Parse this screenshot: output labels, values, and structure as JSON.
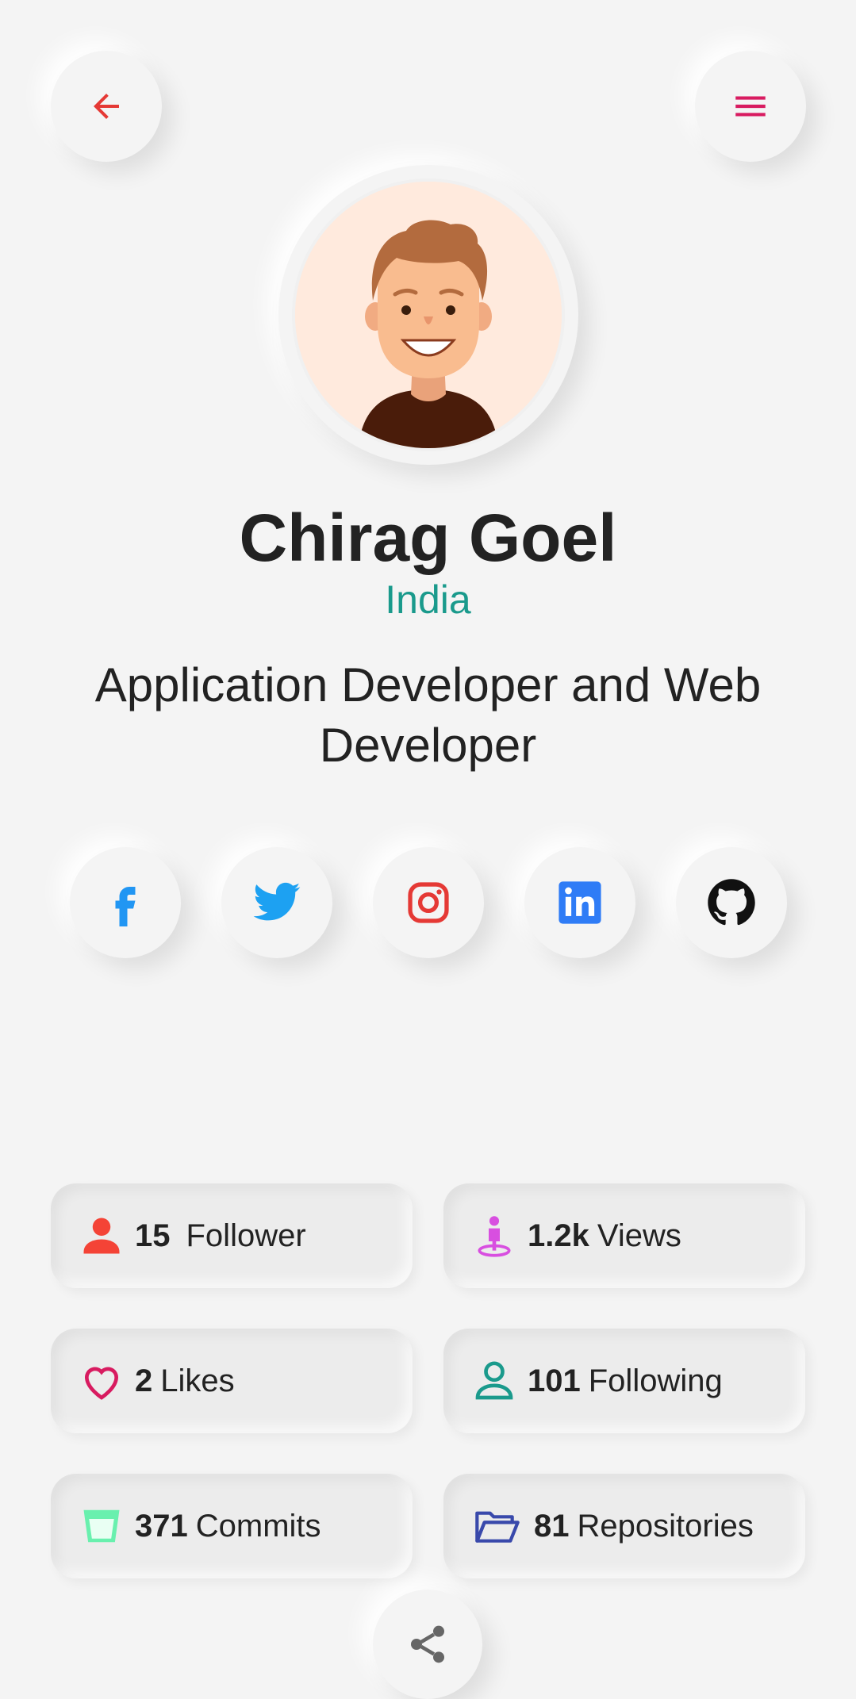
{
  "profile": {
    "name": "Chirag Goel",
    "location": "India",
    "bio": "Application Developer and Web Developer"
  },
  "header": {
    "back_icon": "arrow-left-icon",
    "menu_icon": "menu-icon"
  },
  "social": [
    {
      "name": "facebook-icon",
      "color": "#2196f3"
    },
    {
      "name": "twitter-icon",
      "color": "#1da1f2"
    },
    {
      "name": "instagram-icon",
      "color": "#e53935"
    },
    {
      "name": "linkedin-icon",
      "color": "#2f7cf6"
    },
    {
      "name": "github-icon",
      "color": "#111111"
    }
  ],
  "stats": [
    {
      "value": "15",
      "label": "Follower",
      "icon": "person-icon",
      "color": "#f44336"
    },
    {
      "value": "1.2k",
      "label": "Views",
      "icon": "person-pin-icon",
      "color": "#d84fe0"
    },
    {
      "value": "2",
      "label": "Likes",
      "icon": "heart-icon",
      "color": "#d81b60"
    },
    {
      "value": "101",
      "label": "Following",
      "icon": "person-outline-icon",
      "color": "#1a9a8c"
    },
    {
      "value": "371",
      "label": "Commits",
      "icon": "cup-icon",
      "color": "#69f0ae"
    },
    {
      "value": "81",
      "label": "Repositories",
      "icon": "folder-open-icon",
      "color": "#3949ab"
    }
  ],
  "footer": {
    "share_icon": "share-icon"
  },
  "colors": {
    "accent": "#e53935",
    "menu": "#d81b60",
    "location": "#1a9a8c",
    "background": "#f4f4f4"
  }
}
